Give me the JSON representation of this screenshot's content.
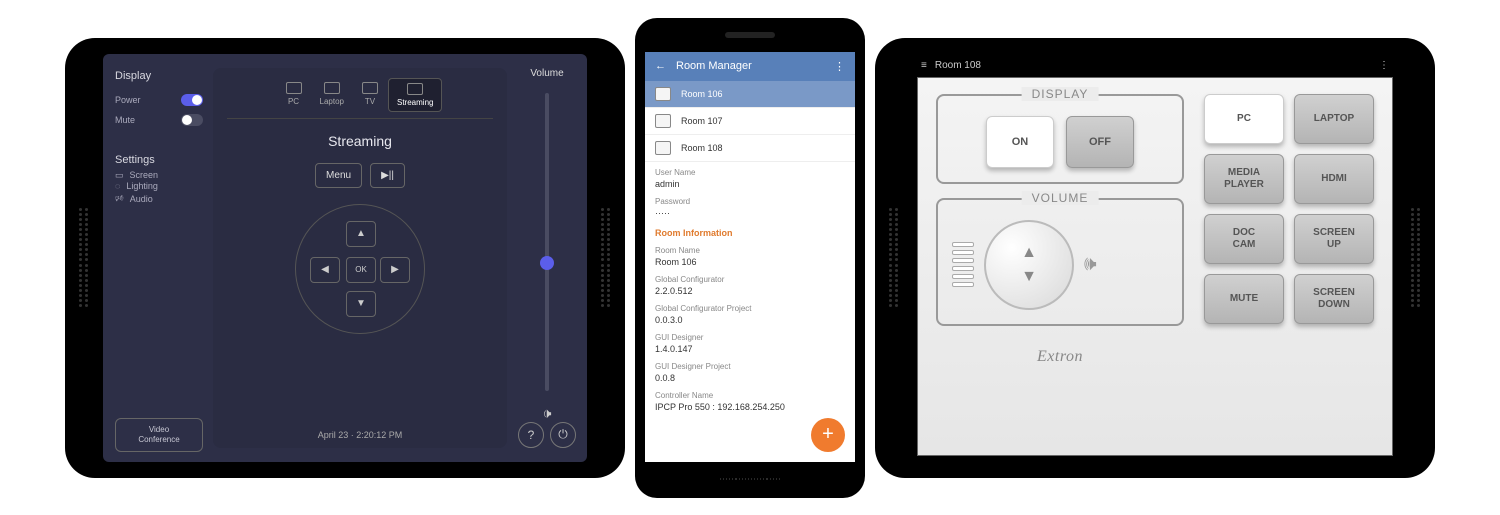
{
  "left": {
    "sidebar": {
      "display_label": "Display",
      "power_label": "Power",
      "mute_label": "Mute",
      "settings_label": "Settings",
      "screen_label": "Screen",
      "lighting_label": "Lighting",
      "audio_label": "Audio",
      "vc_label": "Video\nConference"
    },
    "tabs": [
      {
        "label": "PC"
      },
      {
        "label": "Laptop"
      },
      {
        "label": "TV"
      },
      {
        "label": "Streaming",
        "active": true
      }
    ],
    "title": "Streaming",
    "menu_btn": "Menu",
    "play_btn": "▶||",
    "ok": "OK",
    "timestamp": "April 23 · 2:20:12 PM",
    "volume_label": "Volume",
    "help": "?",
    "power": "⏻"
  },
  "phone": {
    "title": "Room Manager",
    "rooms": [
      "Room 106",
      "Room 107",
      "Room 108"
    ],
    "user_label": "User Name",
    "user_val": "admin",
    "pass_label": "Password",
    "pass_val": "·····",
    "section": "Room Information",
    "fields": [
      {
        "label": "Room Name",
        "val": "Room 106"
      },
      {
        "label": "Global Configurator",
        "val": "2.2.0.512"
      },
      {
        "label": "Global Configurator Project",
        "val": "0.0.3.0"
      },
      {
        "label": "GUI Designer",
        "val": "1.4.0.147"
      },
      {
        "label": "GUI Designer Project",
        "val": "0.0.8"
      },
      {
        "label": "Controller Name",
        "val": "IPCP Pro 550 : 192.168.254.250"
      }
    ],
    "fab": "+"
  },
  "right": {
    "room_title": "Room 108",
    "display_label": "DISPLAY",
    "on": "ON",
    "off": "OFF",
    "volume_label": "VOLUME",
    "buttons": [
      "PC",
      "LAPTOP",
      "MEDIA\nPLAYER",
      "HDMI",
      "DOC\nCAM",
      "SCREEN\nUP",
      "MUTE",
      "SCREEN\nDOWN"
    ],
    "brand": "Extron"
  }
}
